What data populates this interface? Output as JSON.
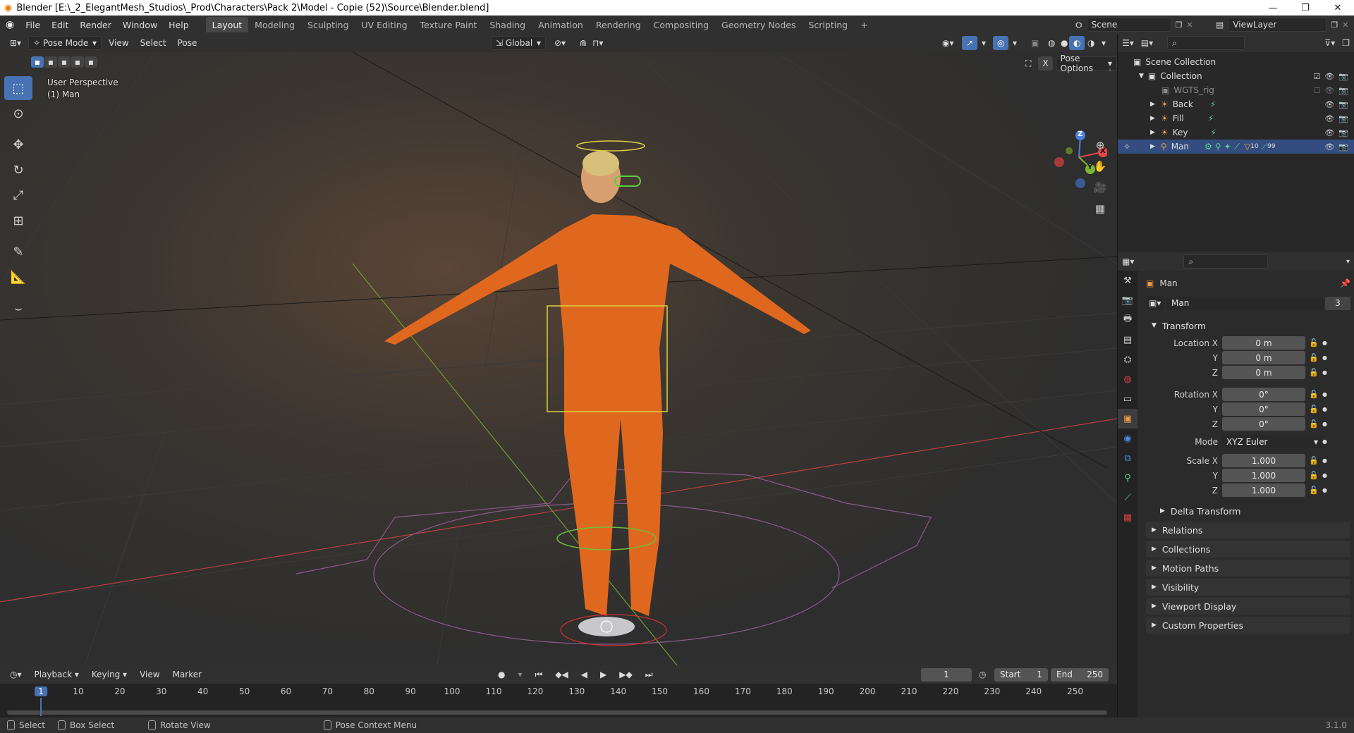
{
  "title_bar": {
    "text": "Blender [E:\\_2_ElegantMesh_Studios\\_Prod\\Characters\\Pack 2\\Model - Copie (52)\\Source\\Blender.blend]"
  },
  "menu": {
    "items": [
      "File",
      "Edit",
      "Render",
      "Window",
      "Help"
    ],
    "workspaces": [
      "Layout",
      "Modeling",
      "Sculpting",
      "UV Editing",
      "Texture Paint",
      "Shading",
      "Animation",
      "Rendering",
      "Compositing",
      "Geometry Nodes",
      "Scripting"
    ],
    "scene": "Scene",
    "view_layer": "ViewLayer"
  },
  "viewport_header": {
    "mode": "Pose Mode",
    "menus": [
      "View",
      "Select",
      "Pose"
    ],
    "orientation": "Global",
    "pose_options": "Pose Options"
  },
  "viewport": {
    "perspective": "User Perspective",
    "object": "(1) Man",
    "gizmo_axes": [
      "Z",
      "Y",
      "X"
    ]
  },
  "outliner": {
    "root": "Scene Collection",
    "collection": "Collection",
    "items": [
      {
        "name": "WGTS_rig",
        "dim": true
      },
      {
        "name": "Back",
        "dim": false
      },
      {
        "name": "Fill",
        "dim": false
      },
      {
        "name": "Key",
        "dim": false
      },
      {
        "name": "Man",
        "dim": false,
        "badge_a": "10",
        "badge_b": "99"
      }
    ]
  },
  "properties": {
    "object_name": "Man",
    "data_name": "Man",
    "users": "3",
    "transform": {
      "header": "Transform",
      "location_label": "Location X",
      "rotation_label": "Rotation X",
      "scale_label": "Scale X",
      "y": "Y",
      "z": "Z",
      "location": [
        "0 m",
        "0 m",
        "0 m"
      ],
      "rotation": [
        "0°",
        "0°",
        "0°"
      ],
      "mode_label": "Mode",
      "mode": "XYZ Euler",
      "scale": [
        "1.000",
        "1.000",
        "1.000"
      ],
      "delta": "Delta Transform"
    },
    "panels": [
      "Relations",
      "Collections",
      "Motion Paths",
      "Visibility",
      "Viewport Display",
      "Custom Properties"
    ]
  },
  "timeline": {
    "menus": [
      "Playback",
      "Keying",
      "View",
      "Marker"
    ],
    "current_frame": "1",
    "start_label": "Start",
    "start": "1",
    "end_label": "End",
    "end": "250",
    "ticks": [
      "1",
      "10",
      "20",
      "30",
      "40",
      "50",
      "60",
      "70",
      "80",
      "90",
      "100",
      "110",
      "120",
      "130",
      "140",
      "150",
      "160",
      "170",
      "180",
      "190",
      "200",
      "210",
      "220",
      "230",
      "240",
      "250"
    ]
  },
  "status_bar": {
    "select": "Select",
    "box_select": "Box Select",
    "rotate_view": "Rotate View",
    "context_menu": "Pose Context Menu",
    "version": "3.1.0"
  }
}
